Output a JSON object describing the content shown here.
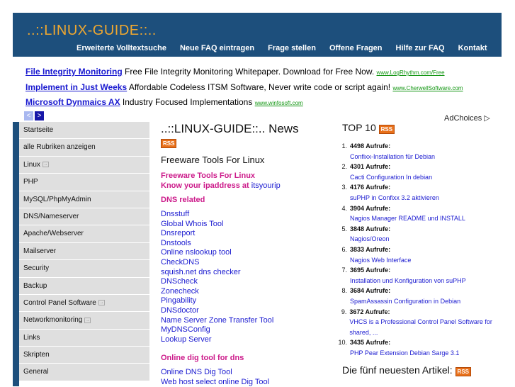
{
  "site_title": "..::LINUX-GUIDE::..",
  "topnav": [
    "Erweiterte Volltextsuche",
    "Neue FAQ eintragen",
    "Frage stellen",
    "Offene Fragen",
    "Hilfe zur FAQ",
    "Kontakt"
  ],
  "ads": [
    {
      "title": "File Integrity Monitoring",
      "text": " Free File Integrity Monitoring Whitepaper. Download for Free Now. ",
      "url": "www.LogRhythm.com/Free"
    },
    {
      "title": "Implement in Just Weeks",
      "text": " Affordable Codeless ITSM Software, Never write code or script again! ",
      "url": "www.CherwellSoftware.com"
    },
    {
      "title": "Microsoft Dynmaics AX",
      "text": " Industry Focused Implementations ",
      "url": "www.winfosoft.com"
    }
  ],
  "pager": {
    "prev": "<",
    "next": ">"
  },
  "adchoices": "AdChoices ▷",
  "sidebar": [
    {
      "label": "Startseite",
      "arrow": false
    },
    {
      "label": "alle Rubriken anzeigen",
      "arrow": false
    },
    {
      "label": "Linux",
      "arrow": true
    },
    {
      "label": "PHP",
      "arrow": false
    },
    {
      "label": "MySQL/PhpMyAdmin",
      "arrow": false
    },
    {
      "label": "DNS/Nameserver",
      "arrow": false
    },
    {
      "label": "Apache/Webserver",
      "arrow": false
    },
    {
      "label": "Mailserver",
      "arrow": false
    },
    {
      "label": "Security",
      "arrow": false
    },
    {
      "label": "Backup",
      "arrow": false
    },
    {
      "label": "Control Panel Software",
      "arrow": true
    },
    {
      "label": "Networkmonitoring",
      "arrow": true
    },
    {
      "label": "Links",
      "arrow": false
    },
    {
      "label": "Skripten",
      "arrow": false
    },
    {
      "label": "General",
      "arrow": false
    }
  ],
  "main": {
    "news_title": "..::LINUX-GUIDE::.. News",
    "rss": "RSS",
    "section_title": "Freeware Tools For Linux",
    "pink_link_1": "Freeware Tools For Linux",
    "pink_link_2": "Know your ipaddress at",
    "pink_link_2b": " itsyourip",
    "dns_heading": "DNS related",
    "dns_links": [
      "Dnsstuff",
      "Global Whois Tool",
      "Dnsreport",
      "Dnstools",
      "Online nslookup tool",
      "CheckDNS",
      "squish.net dns checker",
      "DNScheck",
      "Zonecheck",
      "Pingability",
      "DNSdoctor",
      "Name Server Zone Transfer Tool",
      "MyDNSConfig",
      "Lookup Server"
    ],
    "dig_heading": "Online dig tool for dns",
    "dig_links": [
      "Online DNS Dig Tool",
      "Web host select online Dig Tool"
    ]
  },
  "right": {
    "top10_title": "TOP 10",
    "rss": "RSS",
    "items": [
      {
        "n": "1.",
        "count": "4498 Aufrufe:",
        "title": "Confixx-Installation für Debian"
      },
      {
        "n": "2.",
        "count": "4301 Aufrufe:",
        "title": "Cacti Configuration In debian"
      },
      {
        "n": "3.",
        "count": "4176 Aufrufe:",
        "title": "suPHP in Confixx 3.2 aktivieren"
      },
      {
        "n": "4.",
        "count": "3904 Aufrufe:",
        "title": "Nagios Manager README und INSTALL"
      },
      {
        "n": "5.",
        "count": "3848 Aufrufe:",
        "title": "Nagios/Oreon"
      },
      {
        "n": "6.",
        "count": "3833 Aufrufe:",
        "title": "Nagios Web Interface"
      },
      {
        "n": "7.",
        "count": "3695 Aufrufe:",
        "title": "Installation und Konfiguration von suPHP"
      },
      {
        "n": "8.",
        "count": "3684 Aufrufe:",
        "title": "SpamAssassin Configuration in Debian"
      },
      {
        "n": "9.",
        "count": "3672 Aufrufe:",
        "title": "VHCS is a Professional Control Panel Software for shared, ..."
      },
      {
        "n": "10.",
        "count": "3435 Aufrufe:",
        "title": "PHP Pear Extension Debian Sarge 3.1"
      }
    ],
    "newest_title": "Die fünf neuesten Artikel:",
    "newest_rss": "RSS"
  }
}
